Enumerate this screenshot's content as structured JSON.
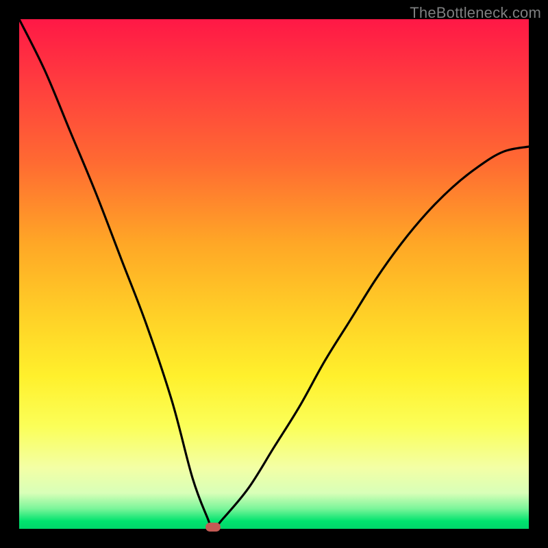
{
  "watermark": "TheBottleneck.com",
  "chart_data": {
    "type": "line",
    "title": "",
    "xlabel": "",
    "ylabel": "",
    "xlim": [
      0,
      100
    ],
    "ylim": [
      0,
      100
    ],
    "grid": false,
    "note": "Background gradient encodes mismatch severity (red=high, green=low). Curve shows bottleneck percentage vs. an x parameter; minimum ≈ 0 at x ≈ 38. Values estimated from pixel positions; chart has no numeric axis labels.",
    "series": [
      {
        "name": "bottleneck-curve",
        "x": [
          0,
          5,
          10,
          15,
          20,
          25,
          30,
          34,
          37,
          38,
          40,
          45,
          50,
          55,
          60,
          65,
          70,
          75,
          80,
          85,
          90,
          95,
          100
        ],
        "values": [
          100,
          90,
          78,
          66,
          53,
          40,
          25,
          10,
          2,
          0,
          2,
          8,
          16,
          24,
          33,
          41,
          49,
          56,
          62,
          67,
          71,
          74,
          75
        ]
      }
    ],
    "marker": {
      "x": 38,
      "y": 0,
      "label": "optimal-point"
    },
    "background_gradient": {
      "direction": "top-to-bottom",
      "stops": [
        {
          "pos": 0.0,
          "color": "#ff1846"
        },
        {
          "pos": 0.28,
          "color": "#ff6a32"
        },
        {
          "pos": 0.58,
          "color": "#ffd027"
        },
        {
          "pos": 0.8,
          "color": "#fbff59"
        },
        {
          "pos": 0.96,
          "color": "#7cf59a"
        },
        {
          "pos": 1.0,
          "color": "#00d66a"
        }
      ]
    }
  }
}
